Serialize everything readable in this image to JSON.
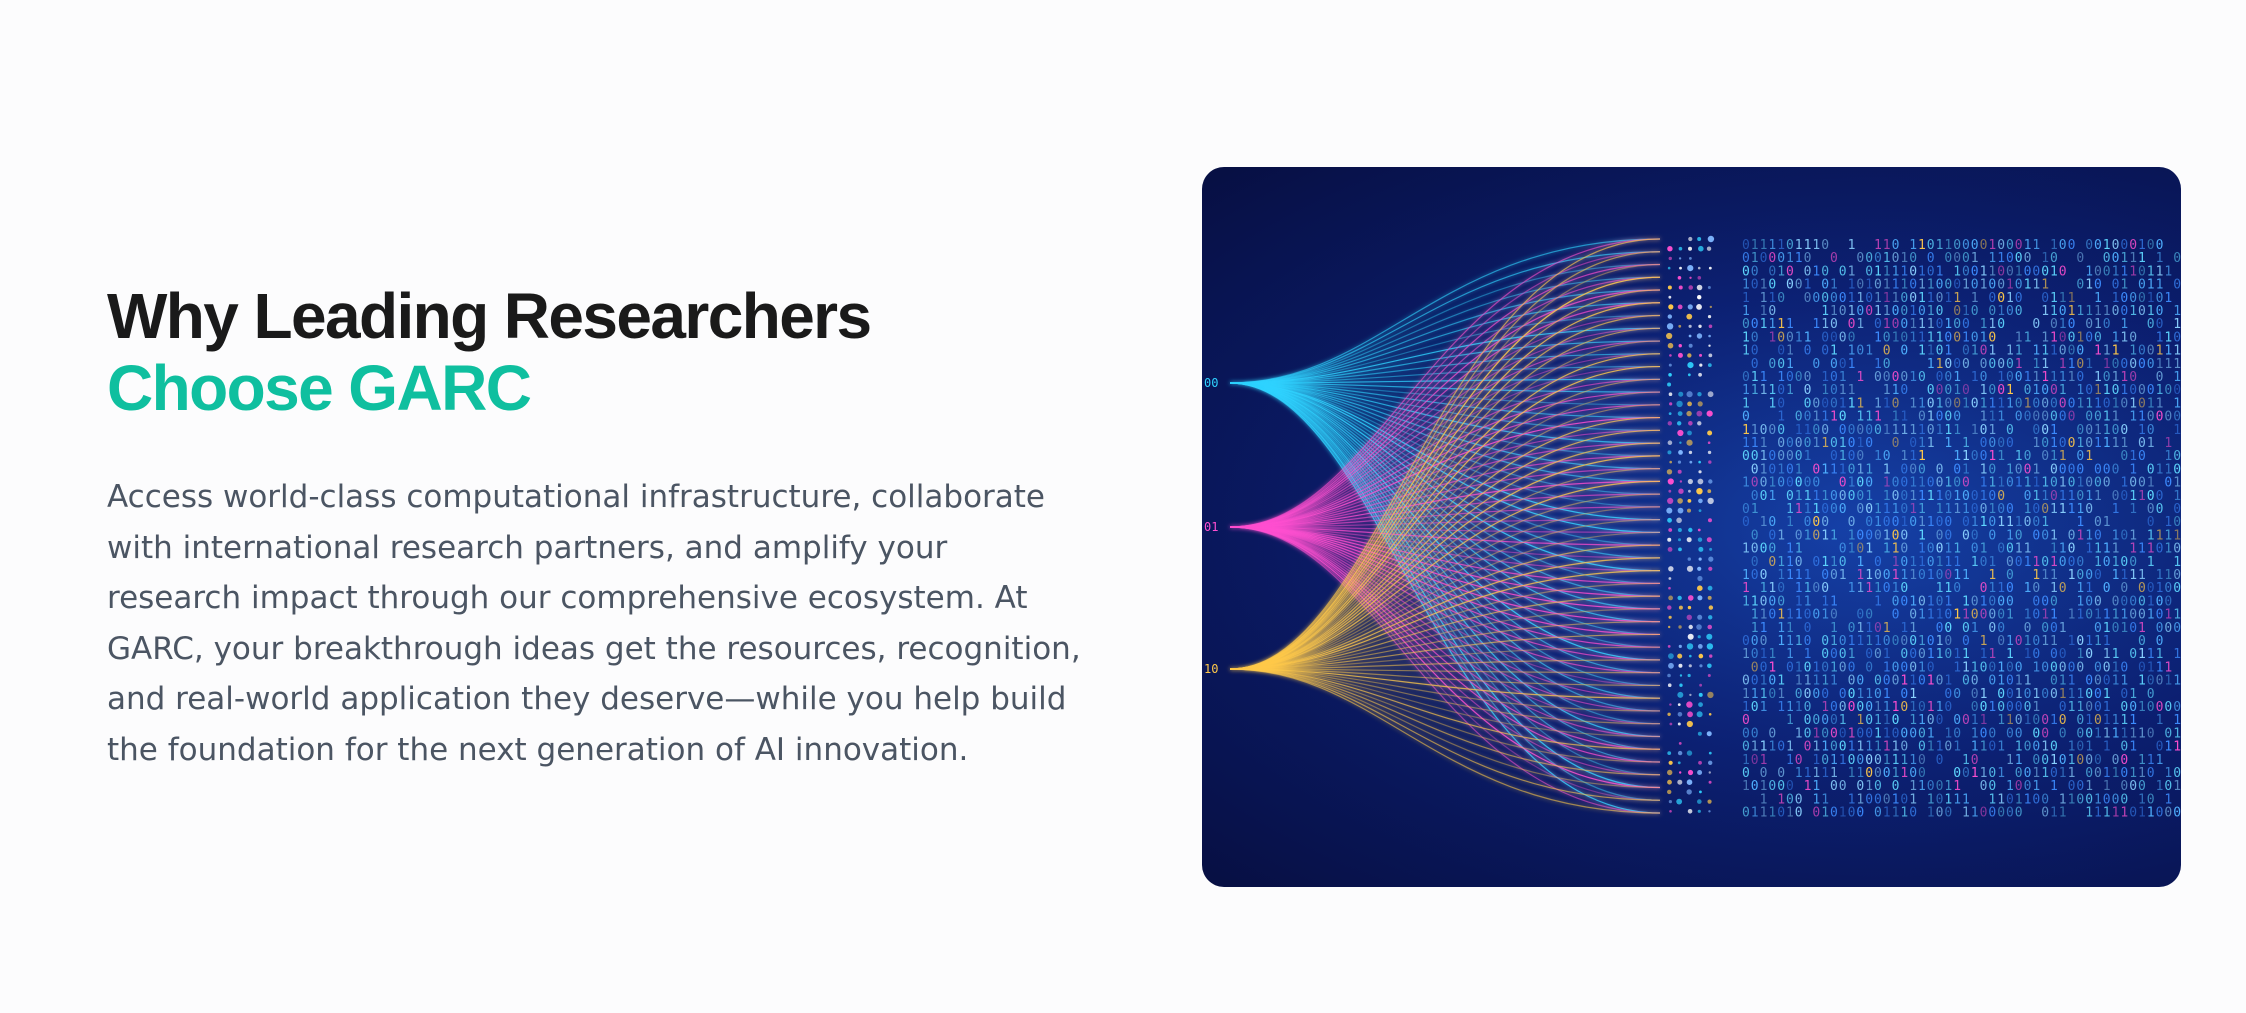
{
  "section": {
    "heading_line1": "Why Leading Researchers",
    "heading_line2": "Choose GARC",
    "body": "Access world-class computational infrastructure, collaborate with international research partners, and amplify your research impact through our comprehensive ecosystem. At GARC, your breakthrough ideas get the resources, recognition, and real-world application they deserve—while you help build the foundation for the next generation of AI innovation."
  },
  "colors": {
    "heading": "#1a1a1a",
    "accent": "#0fbf9f",
    "body_text": "#4b5563",
    "background": "#fcfcfd",
    "image_bg": "#0b1e72",
    "stream_cyan": "#2fd3ff",
    "stream_magenta": "#ff4fd0",
    "stream_gold": "#ffc94a"
  },
  "image": {
    "description_icon": "data-streams-illustration",
    "stream_labels": [
      "00",
      "01",
      "10"
    ]
  }
}
